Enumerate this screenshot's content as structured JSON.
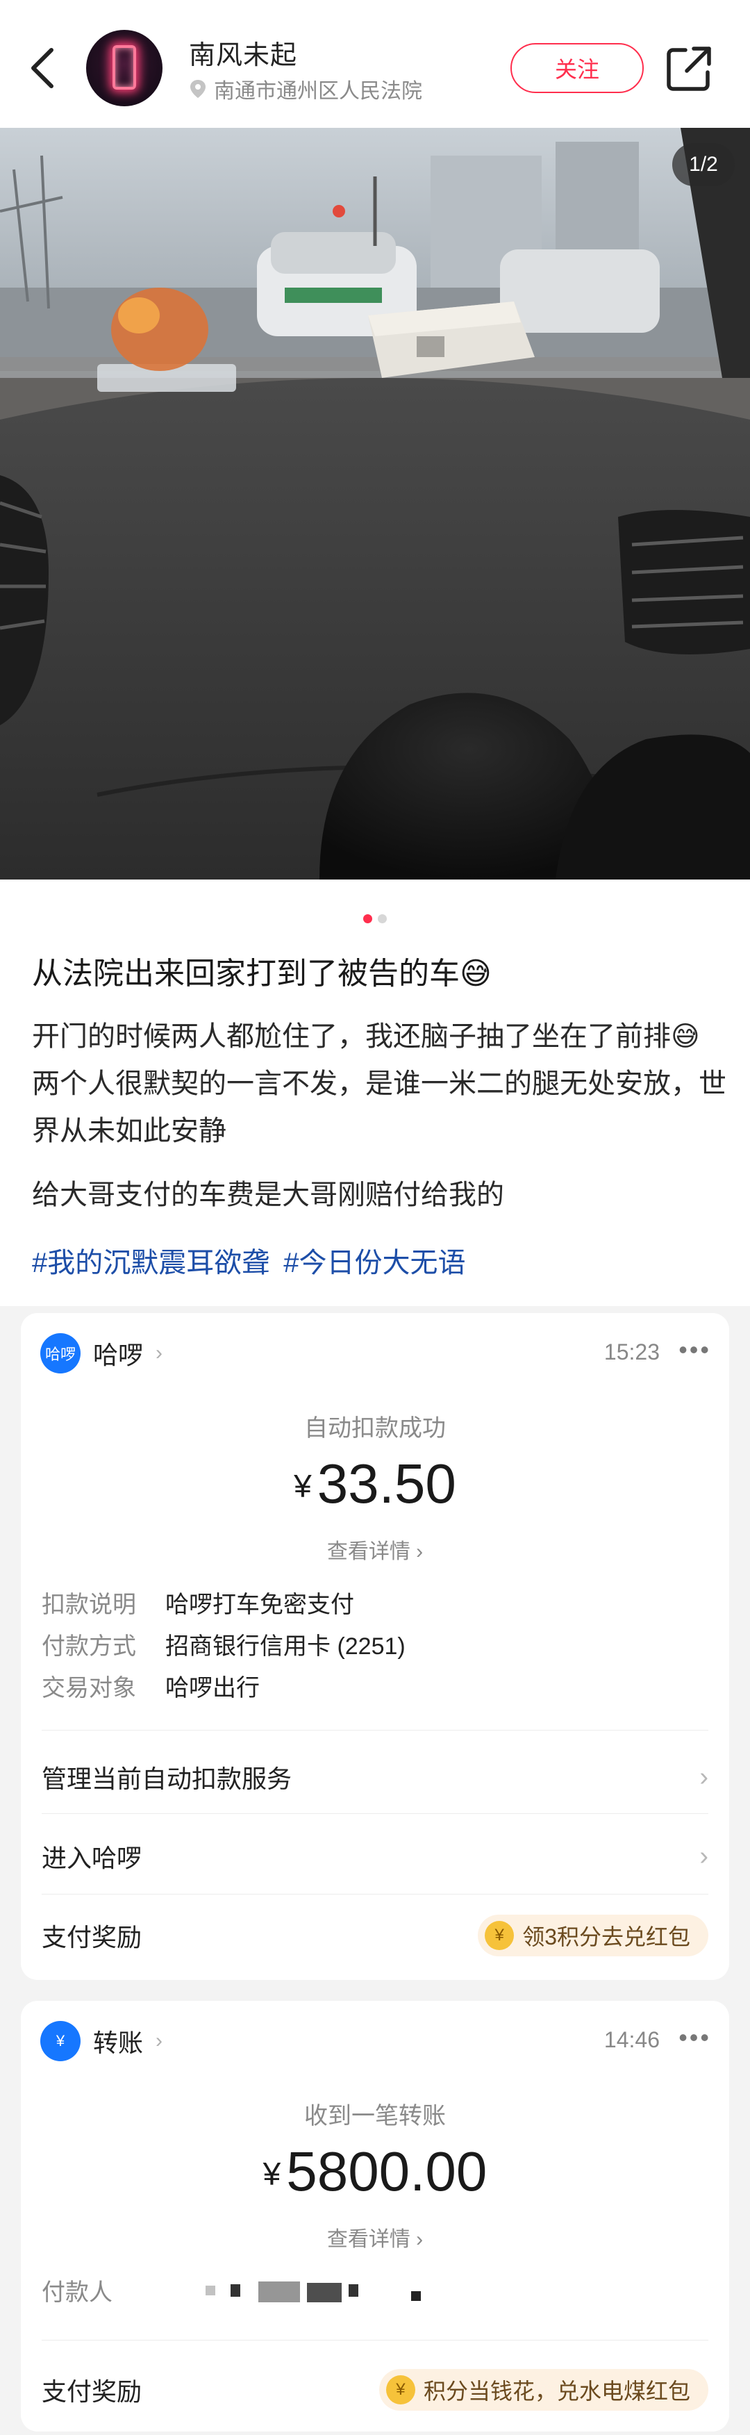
{
  "header": {
    "author": "南风未起",
    "location": "南通市通州区人民法院",
    "follow_label": "关注"
  },
  "photo": {
    "counter": "1/2"
  },
  "post": {
    "title": "从法院出来回家打到了被告的车😅",
    "body": "开门的时候两人都尬住了，我还脑子抽了坐在了前排😅两个人很默契的一言不发，是谁一米二的腿无处安放，世界从未如此安静",
    "body2": "给大哥支付的车费是大哥刚赔付给我的",
    "hashtags": [
      "#我的沉默震耳欲聋",
      "#今日份大无语"
    ]
  },
  "card1": {
    "app_logo": "哈啰",
    "app_name": "哈啰",
    "time": "15:23",
    "status": "自动扣款成功",
    "currency": "¥",
    "amount": "33.50",
    "detail_link": "查看详情",
    "fields": [
      {
        "label": "扣款说明",
        "value": "哈啰打车免密支付"
      },
      {
        "label": "付款方式",
        "value": "招商银行信用卡 (2251)"
      },
      {
        "label": "交易对象",
        "value": "哈啰出行"
      }
    ],
    "rows": {
      "manage": "管理当前自动扣款服务",
      "enter": "进入哈啰",
      "reward": "支付奖励"
    },
    "reward_pill": "领3积分去兑红包"
  },
  "card2": {
    "app_name": "转账",
    "time": "14:46",
    "status": "收到一笔转账",
    "currency": "¥",
    "amount": "5800.00",
    "detail_link": "查看详情",
    "payer_label": "付款人",
    "reward_label": "支付奖励",
    "reward_pill": "积分当钱花，兑水电煤红包"
  },
  "icons": {
    "back": "back-arrow-icon",
    "share": "share-icon",
    "location": "location-pin-icon",
    "more": "more-icon",
    "coin": "points-coin-icon"
  },
  "colors": {
    "accent": "#ff2e4d",
    "hashtag": "#1d4ea8",
    "alipay_blue": "#1677ff"
  }
}
